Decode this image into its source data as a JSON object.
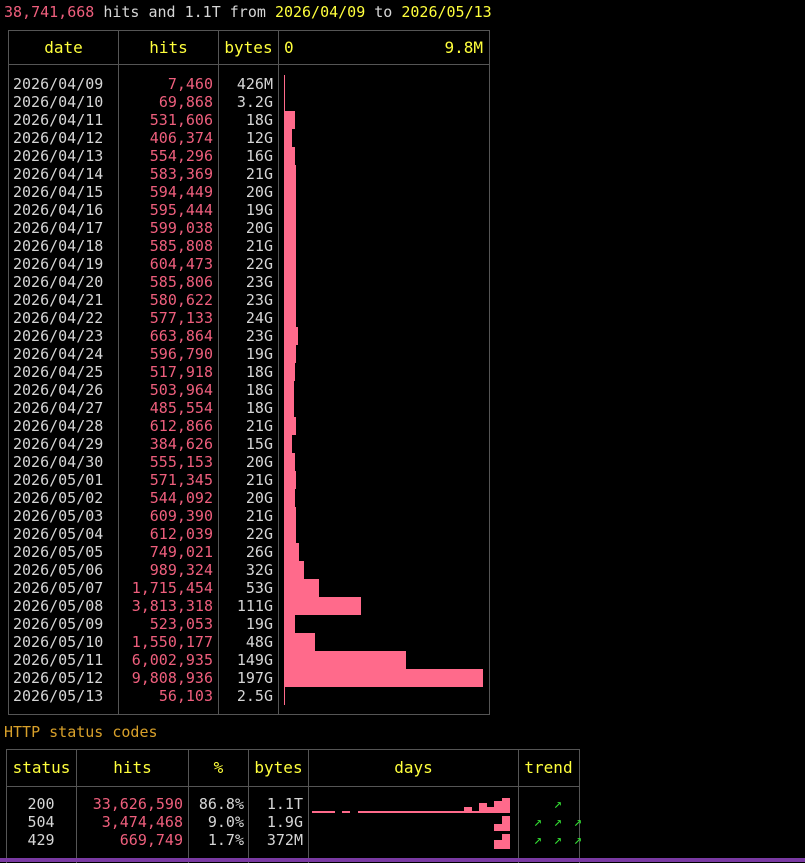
{
  "summary": {
    "total_hits": "38,741,668",
    "hits_word": " hits and ",
    "total_bytes": "1.1T",
    "from_word": " from ",
    "start_date": "2026/04/09",
    "to_word": " to ",
    "end_date": "2026/05/13"
  },
  "daily": {
    "headers": {
      "date": "date",
      "hits": "hits",
      "bytes": "bytes",
      "scale_min": "0",
      "scale_max": "9.8M"
    },
    "max_hits": 9808936,
    "rows": [
      {
        "date": "2026/04/09",
        "hits": "7,460",
        "hits_value": 7460,
        "bytes": "426M"
      },
      {
        "date": "2026/04/10",
        "hits": "69,868",
        "hits_value": 69868,
        "bytes": "3.2G"
      },
      {
        "date": "2026/04/11",
        "hits": "531,606",
        "hits_value": 531606,
        "bytes": "18G"
      },
      {
        "date": "2026/04/12",
        "hits": "406,374",
        "hits_value": 406374,
        "bytes": "12G"
      },
      {
        "date": "2026/04/13",
        "hits": "554,296",
        "hits_value": 554296,
        "bytes": "16G"
      },
      {
        "date": "2026/04/14",
        "hits": "583,369",
        "hits_value": 583369,
        "bytes": "21G"
      },
      {
        "date": "2026/04/15",
        "hits": "594,449",
        "hits_value": 594449,
        "bytes": "20G"
      },
      {
        "date": "2026/04/16",
        "hits": "595,444",
        "hits_value": 595444,
        "bytes": "19G"
      },
      {
        "date": "2026/04/17",
        "hits": "599,038",
        "hits_value": 599038,
        "bytes": "20G"
      },
      {
        "date": "2026/04/18",
        "hits": "585,808",
        "hits_value": 585808,
        "bytes": "21G"
      },
      {
        "date": "2026/04/19",
        "hits": "604,473",
        "hits_value": 604473,
        "bytes": "22G"
      },
      {
        "date": "2026/04/20",
        "hits": "585,806",
        "hits_value": 585806,
        "bytes": "23G"
      },
      {
        "date": "2026/04/21",
        "hits": "580,622",
        "hits_value": 580622,
        "bytes": "23G"
      },
      {
        "date": "2026/04/22",
        "hits": "577,133",
        "hits_value": 577133,
        "bytes": "24G"
      },
      {
        "date": "2026/04/23",
        "hits": "663,864",
        "hits_value": 663864,
        "bytes": "23G"
      },
      {
        "date": "2026/04/24",
        "hits": "596,790",
        "hits_value": 596790,
        "bytes": "19G"
      },
      {
        "date": "2026/04/25",
        "hits": "517,918",
        "hits_value": 517918,
        "bytes": "18G"
      },
      {
        "date": "2026/04/26",
        "hits": "503,964",
        "hits_value": 503964,
        "bytes": "18G"
      },
      {
        "date": "2026/04/27",
        "hits": "485,554",
        "hits_value": 485554,
        "bytes": "18G"
      },
      {
        "date": "2026/04/28",
        "hits": "612,866",
        "hits_value": 612866,
        "bytes": "21G"
      },
      {
        "date": "2026/04/29",
        "hits": "384,626",
        "hits_value": 384626,
        "bytes": "15G"
      },
      {
        "date": "2026/04/30",
        "hits": "555,153",
        "hits_value": 555153,
        "bytes": "20G"
      },
      {
        "date": "2026/05/01",
        "hits": "571,345",
        "hits_value": 571345,
        "bytes": "21G"
      },
      {
        "date": "2026/05/02",
        "hits": "544,092",
        "hits_value": 544092,
        "bytes": "20G"
      },
      {
        "date": "2026/05/03",
        "hits": "609,390",
        "hits_value": 609390,
        "bytes": "21G"
      },
      {
        "date": "2026/05/04",
        "hits": "612,039",
        "hits_value": 612039,
        "bytes": "22G"
      },
      {
        "date": "2026/05/05",
        "hits": "749,021",
        "hits_value": 749021,
        "bytes": "26G"
      },
      {
        "date": "2026/05/06",
        "hits": "989,324",
        "hits_value": 989324,
        "bytes": "32G"
      },
      {
        "date": "2026/05/07",
        "hits": "1,715,454",
        "hits_value": 1715454,
        "bytes": "53G"
      },
      {
        "date": "2026/05/08",
        "hits": "3,813,318",
        "hits_value": 3813318,
        "bytes": "111G"
      },
      {
        "date": "2026/05/09",
        "hits": "523,053",
        "hits_value": 523053,
        "bytes": "19G"
      },
      {
        "date": "2026/05/10",
        "hits": "1,550,177",
        "hits_value": 1550177,
        "bytes": "48G"
      },
      {
        "date": "2026/05/11",
        "hits": "6,002,935",
        "hits_value": 6002935,
        "bytes": "149G"
      },
      {
        "date": "2026/05/12",
        "hits": "9,808,936",
        "hits_value": 9808936,
        "bytes": "197G"
      },
      {
        "date": "2026/05/13",
        "hits": "56,103",
        "hits_value": 56103,
        "bytes": "2.5G"
      }
    ]
  },
  "http_status": {
    "title": "HTTP status codes",
    "headers": {
      "status": "status",
      "hits": "hits",
      "pct": "%",
      "bytes": "bytes",
      "days": "days",
      "trend": "trend"
    },
    "rows": [
      {
        "status": "200",
        "hits": "33,626,590",
        "pct": "86.8%",
        "bytes": "1.1T",
        "days": [
          0.07,
          0.07,
          0.07,
          0,
          0.07,
          0,
          0.07,
          0.07,
          0.07,
          0.07,
          0.07,
          0.07,
          0.07,
          0.07,
          0.07,
          0.07,
          0.07,
          0.07,
          0.07,
          0.15,
          0.35,
          0.15,
          0.6,
          0.35,
          0.75,
          0.95
        ],
        "days_start": 0,
        "trend": [
          "up-right-arrow"
        ]
      },
      {
        "status": "504",
        "hits": "3,474,468",
        "pct": "9.0%",
        "bytes": "1.9G",
        "days": [
          0.45,
          0.95
        ],
        "days_start": 24,
        "trend": [
          "up-right-arrow",
          "up-right-arrow",
          "up-right-arrow"
        ]
      },
      {
        "status": "429",
        "hits": "669,749",
        "pct": "1.7%",
        "bytes": "372M",
        "days": [
          0.55,
          0.95
        ],
        "days_start": 24,
        "trend": [
          "up-right-arrow",
          "up-right-arrow",
          "up-right-arrow"
        ]
      }
    ]
  },
  "colors": {
    "hits": "#ef5f7d",
    "bars": "#ff6a8b",
    "header": "#ffff3c",
    "title": "#d8a02a",
    "trend": "#33dd33"
  }
}
